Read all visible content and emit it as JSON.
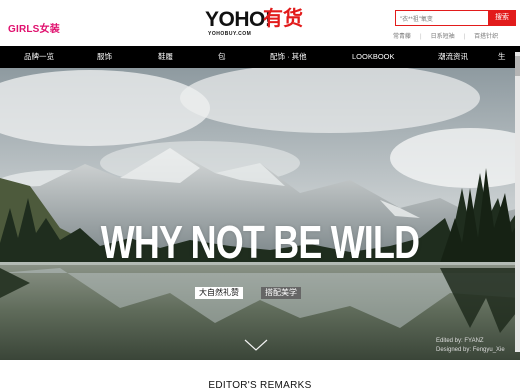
{
  "header": {
    "section_label": "GIRLS女装",
    "logo_brand": "YOHO!",
    "logo_cn": "有货",
    "logo_domain": "YOHOBUY.COM",
    "search_value": "\"衣**祖\"氧变",
    "search_button": "搜索",
    "links": [
      "常青藤",
      "日系短袖",
      "百搭针织"
    ]
  },
  "nav": {
    "items": [
      "品牌一览",
      "服饰",
      "鞋履",
      "包",
      "配饰 · 其他",
      "LOOKBOOK",
      "潮流资讯",
      "生"
    ]
  },
  "hero": {
    "headline": "WHY NOT BE WILD",
    "tag1": "大自然礼赞",
    "tag2": "搭配美学",
    "credit_line1": "Edited by: FYANZ",
    "credit_line2": "Designed by: Fengyu_Xie",
    "arrow_icon": "chevron-down-icon"
  },
  "footer": {
    "editor_title": "EDITOR'S REMARKS"
  },
  "colors": {
    "accent": "#e21b1b",
    "girls": "#e0106e",
    "nav_bg": "#000000"
  }
}
